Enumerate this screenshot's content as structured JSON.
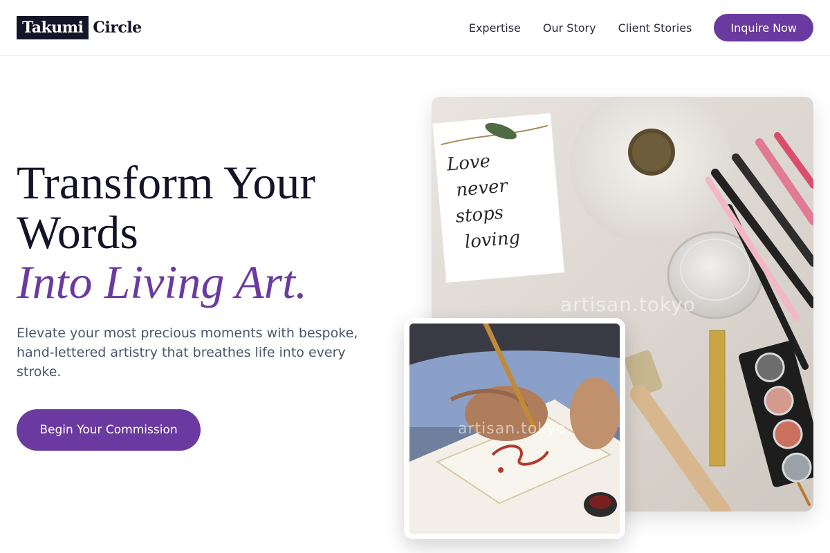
{
  "header": {
    "logo_box": "Takumi",
    "logo_rest": "Circle",
    "nav": [
      "Expertise",
      "Our Story",
      "Client Stories"
    ],
    "cta": "Inquire Now"
  },
  "hero": {
    "title_line1": "Transform Your",
    "title_line2": "Words",
    "title_accent": "Into Living Art.",
    "subtitle": "Elevate your most precious moments with bespoke, hand-lettered artistry that breathes life into every stroke.",
    "cta": "Begin Your Commission"
  },
  "images": {
    "watermark_main": "artisan.tokyo",
    "watermark_inset": "artisan.tokyo",
    "card_text_1": "Love",
    "card_text_2": "never",
    "card_text_3": "stops",
    "card_text_4": "loving"
  },
  "colors": {
    "accent": "#6b3aa0",
    "dark": "#151528",
    "body_text": "#4a5468"
  }
}
